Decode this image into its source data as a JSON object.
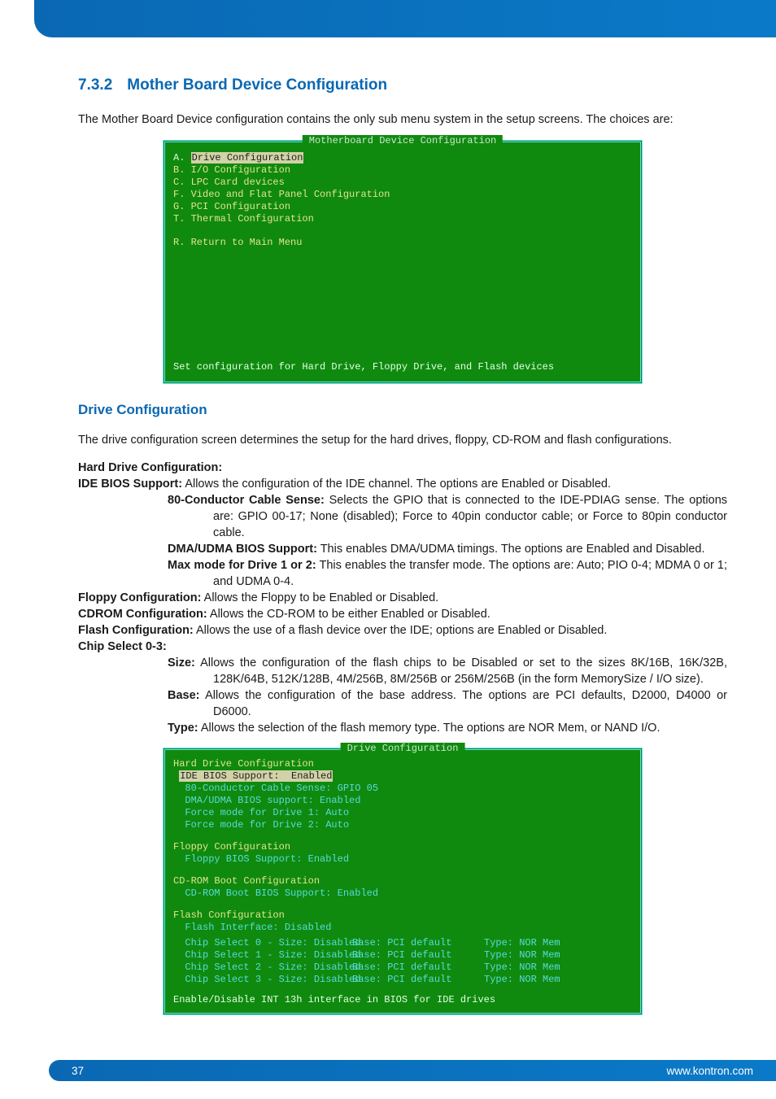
{
  "section": {
    "number": "7.3.2",
    "title": "Mother Board Device Configuration"
  },
  "intro": "The Mother Board Device configuration contains the only sub menu system in the setup screens. The choices are:",
  "bios1": {
    "title": "Motherboard Device Configuration",
    "items": [
      {
        "key": "A.",
        "label": "Drive Configuration",
        "hi": true
      },
      {
        "key": "B.",
        "label": "I/O Configuration"
      },
      {
        "key": "C.",
        "label": "LPC Card devices"
      },
      {
        "key": "F.",
        "label": "Video and Flat Panel Configuration"
      },
      {
        "key": "G.",
        "label": "PCI Configuration"
      },
      {
        "key": "T.",
        "label": "Thermal Configuration"
      }
    ],
    "return": {
      "key": "R.",
      "label": "Return to Main Menu"
    },
    "status": "Set configuration for Hard Drive, Floppy Drive, and Flash devices"
  },
  "subheading": "Drive Configuration",
  "subintro": "The drive configuration screen determines the setup for the hard drives, floppy, CD-ROM and flash configurations.",
  "hd_heading": "Hard Drive Configuration:",
  "defs": {
    "ide": {
      "label": "IDE BIOS Support:",
      "text": " Allows the configuration of the IDE channel. The options are Enabled or Disabled."
    },
    "cable": {
      "label": "80-Conductor Cable Sense:",
      "text": " Selects the GPIO that is connected to the IDE-PDIAG sense. The options are: GPIO 00-17; None (disabled); Force to 40pin conductor cable; or Force to 80pin conductor cable."
    },
    "dma": {
      "label": "DMA/UDMA BIOS Support:",
      "text": " This enables DMA/UDMA timings. The options are Enabled and Disabled."
    },
    "max": {
      "label": "Max mode for Drive 1 or 2:",
      "text": " This enables the transfer mode. The options are: Auto; PIO 0-4; MDMA 0 or 1; and UDMA 0-4."
    },
    "floppy": {
      "label": "Floppy Configuration:",
      "text": " Allows the Floppy to be Enabled or Disabled."
    },
    "cdrom": {
      "label": "CDROM Configuration:",
      "text": " Allows the CD-ROM to be either Enabled or Disabled."
    },
    "flash": {
      "label": "Flash Configuration:",
      "text": " Allows the use of a flash device over the IDE; options are Enabled or Disabled."
    },
    "chip_heading": "Chip Select 0-3:",
    "size": {
      "label": "Size:",
      "text": " Allows the configuration of the flash chips to be Disabled or set to the sizes 8K/16B, 16K/32B, 128K/64B, 512K/128B, 4M/256B, 8M/256B or 256M/256B (in the form MemorySize / I/O size)."
    },
    "base": {
      "label": "Base:",
      "text": " Allows the configuration of the base address. The options are PCI defaults, D2000, D4000 or D6000."
    },
    "type": {
      "label": "Type:",
      "text": " Allows the selection of the flash memory type. The options are NOR Mem, or NAND I/O."
    }
  },
  "bios2": {
    "title": "Drive Configuration",
    "hd_head": "Hard Drive Configuration",
    "ide_line": "IDE BIOS Support:  Enabled",
    "lines1": [
      "  80-Conductor Cable Sense: GPIO 05",
      "  DMA/UDMA BIOS support: Enabled",
      "  Force mode for Drive 1: Auto",
      "  Force mode for Drive 2: Auto"
    ],
    "floppy_head": "Floppy Configuration",
    "floppy_line": "  Floppy BIOS Support: Enabled",
    "cd_head": "CD-ROM Boot Configuration",
    "cd_line": "  CD-ROM Boot BIOS Support: Enabled",
    "flash_head": "Flash Configuration",
    "flash_iface": "  Flash Interface: Disabled",
    "chips": [
      {
        "a": "  Chip Select 0 - Size: Disabled",
        "b": "Base: PCI default",
        "c": "Type: NOR Mem"
      },
      {
        "a": "  Chip Select 1 - Size: Disabled",
        "b": "Base: PCI default",
        "c": "Type: NOR Mem"
      },
      {
        "a": "  Chip Select 2 - Size: Disabled",
        "b": "Base: PCI default",
        "c": "Type: NOR Mem"
      },
      {
        "a": "  Chip Select 3 - Size: Disabled",
        "b": "Base: PCI default",
        "c": "Type: NOR Mem"
      }
    ],
    "status": "Enable/Disable INT 13h interface in BIOS for IDE drives"
  },
  "footer": {
    "page": "37",
    "url": "www.kontron.com"
  }
}
